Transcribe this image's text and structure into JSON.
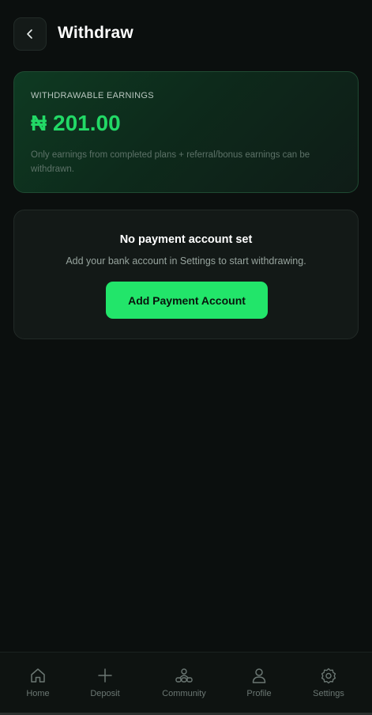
{
  "header": {
    "title": "Withdraw",
    "back_icon": "chevron-left-icon"
  },
  "earnings": {
    "label": "WITHDRAWABLE EARNINGS",
    "amount": "₦ 201.00",
    "note": "Only earnings from completed plans + referral/bonus earnings can be withdrawn."
  },
  "payment": {
    "title": "No payment account set",
    "subtitle": "Add your bank account in Settings to start withdrawing.",
    "button_label": "Add Payment Account"
  },
  "nav": {
    "items": [
      {
        "label": "Home",
        "icon": "home-icon"
      },
      {
        "label": "Deposit",
        "icon": "plus-icon"
      },
      {
        "label": "Community",
        "icon": "community-icon"
      },
      {
        "label": "Profile",
        "icon": "profile-icon"
      },
      {
        "label": "Settings",
        "icon": "gear-icon"
      }
    ]
  },
  "colors": {
    "background": "#0b0f0e",
    "accent": "#22e56a",
    "amount": "#22d966"
  }
}
